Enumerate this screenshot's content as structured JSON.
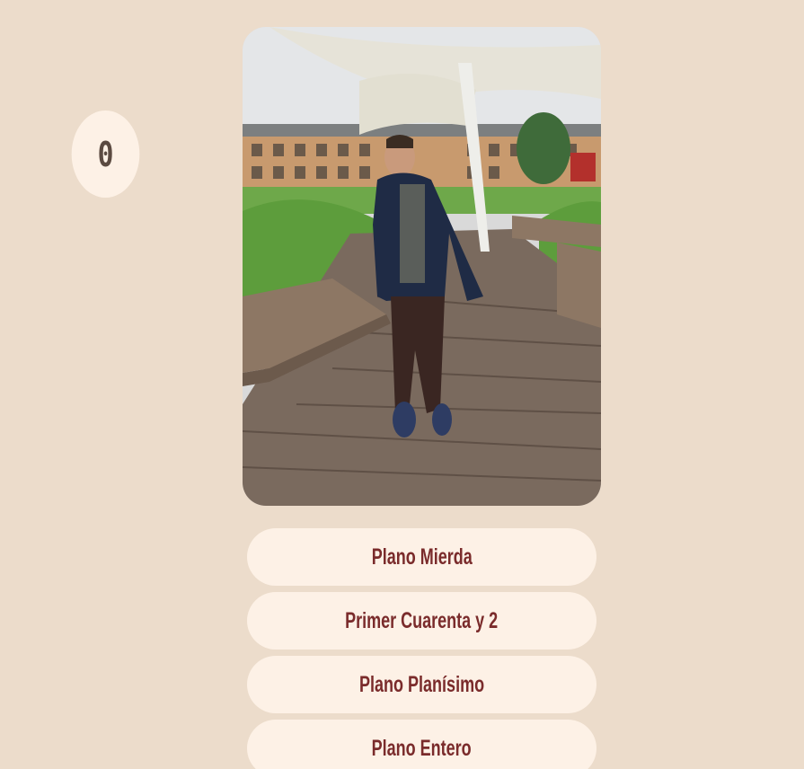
{
  "score": {
    "value": "0"
  },
  "photo": {
    "icon": "photo-of-person-outdoors",
    "description_hidden": ""
  },
  "options": [
    {
      "label": "Plano Mierda"
    },
    {
      "label": "Primer Cuarenta y 2"
    },
    {
      "label": "Plano Planísimo"
    },
    {
      "label": "Plano Entero"
    }
  ],
  "colors": {
    "background": "#ecdccb",
    "button_bg": "#fdf1e6",
    "button_text": "#7a2b2b",
    "score_text": "#5b4a41"
  }
}
